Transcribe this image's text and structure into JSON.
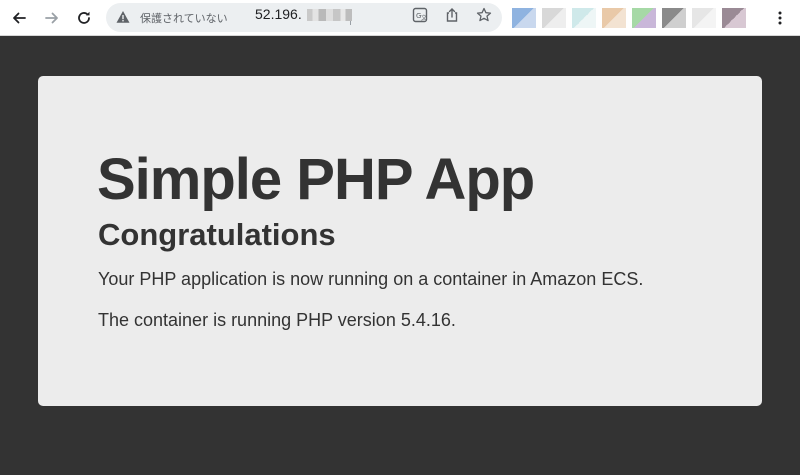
{
  "browser": {
    "security_label": "保護されていない",
    "url_visible": "52.196."
  },
  "page": {
    "title": "Simple PHP App",
    "subtitle": "Congratulations",
    "paragraph1": "Your PHP application is now running on a container in Amazon ECS.",
    "paragraph2": "The container is running PHP version 5.4.16."
  },
  "colors": {
    "page_background": "#333333",
    "card_background": "#ececec",
    "text": "#333333"
  }
}
